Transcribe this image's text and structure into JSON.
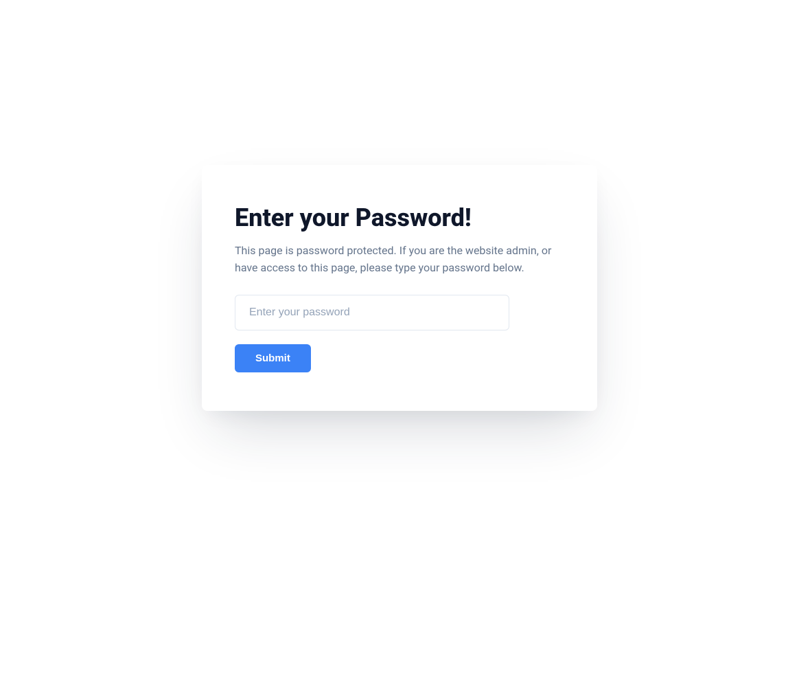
{
  "card": {
    "title": "Enter your Password!",
    "description": "This page is password protected. If you are the website admin, or have access to this page, please type your password below.",
    "input": {
      "placeholder": "Enter your password",
      "value": ""
    },
    "submit_label": "Submit"
  },
  "colors": {
    "accent": "#3b82f6",
    "title": "#0f172a",
    "text": "#64748b",
    "placeholder": "#94a3b8",
    "border": "#e2e8f0"
  }
}
